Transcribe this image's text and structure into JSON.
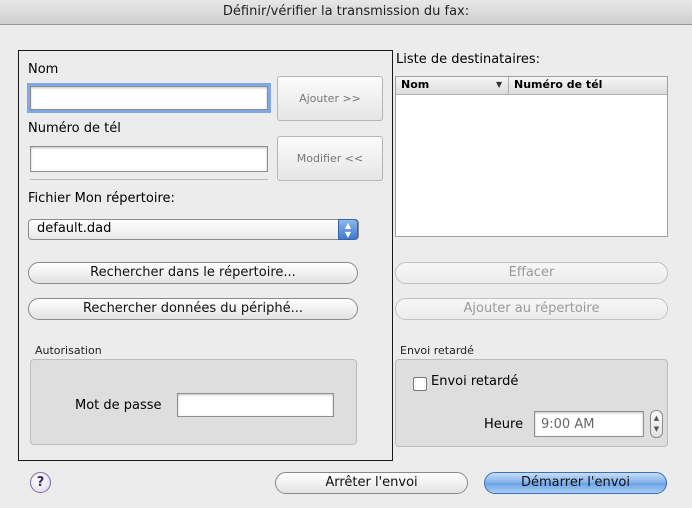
{
  "title": "Définir/vérifier la transmission du fax:",
  "left": {
    "name_label": "Nom",
    "name_value": "",
    "phone_label": "Numéro de tél",
    "phone_value": "",
    "add_button": "Ajouter >>",
    "modify_button": "Modifier <<",
    "addressbook_label": "Fichier Mon répertoire:",
    "addressbook_selected": "default.dad",
    "search_addressbook_button": "Rechercher dans le répertoire...",
    "search_device_button": "Rechercher données du périphé...",
    "auth_group_label": "Autorisation",
    "password_label": "Mot de passe",
    "password_value": ""
  },
  "right": {
    "recipients_label": "Liste de destinataires:",
    "columns": [
      "Nom",
      "Numéro de tél"
    ],
    "rows": [],
    "delete_button": "Effacer",
    "add_to_addressbook_button": "Ajouter au répertoire",
    "delayed_group_label": "Envoi retardé",
    "delayed_checkbox_label": "Envoi retardé",
    "delayed_checked": false,
    "time_label": "Heure",
    "time_value": "9:00 AM"
  },
  "footer": {
    "help_symbol": "?",
    "stop_button": "Arrêter l'envoi",
    "start_button": "Démarrer l'envoi"
  },
  "colors": {
    "accent": "#6aa2e6",
    "focus_ring": "#7ea9e6"
  }
}
